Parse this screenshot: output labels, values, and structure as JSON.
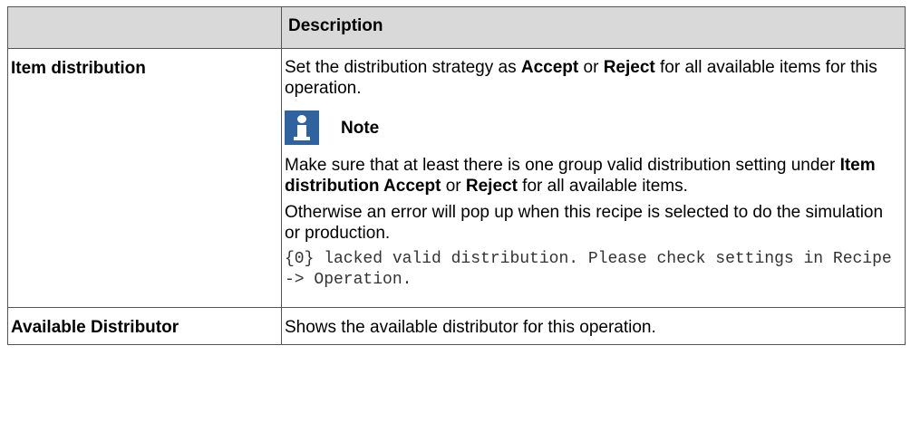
{
  "table": {
    "header": {
      "col1": "",
      "col2": "Description"
    },
    "rows": {
      "item_distribution": {
        "label": "Item distribution",
        "p1_before": "Set the distribution strategy as ",
        "p1_accept": "Accept",
        "p1_mid": " or ",
        "p1_reject": "Reject",
        "p1_after": " for all available items for this operation.",
        "note_title": "Note",
        "p2_before": "Make sure that at least there is one group valid distribution setting under ",
        "p2_bold": "Item distribution Accept",
        "p2_mid": " or ",
        "p2_reject": "Reject",
        "p2_after": " for all available items.",
        "p3": "Otherwise an error will pop up when this recipe is selected to do the simulation or production.",
        "code": "{0} lacked valid distribution. Please check settings in Recipe -> Operation."
      },
      "available_distributor": {
        "label": "Available Distributor",
        "description": "Shows the available distributor for this operation."
      }
    }
  },
  "icons": {
    "note": "info-icon"
  },
  "colors": {
    "note_icon_bg": "#2f63a0",
    "header_bg": "#d9d9d9"
  }
}
